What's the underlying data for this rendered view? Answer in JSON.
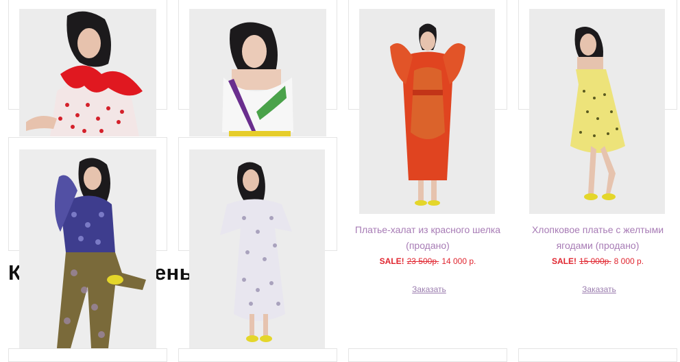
{
  "section_heading": "Коллекция осень-зима 2015",
  "products": [
    {
      "name": "Платье-халат из красного шелка (продано)",
      "sale_label": "SALE!",
      "old_price": "23 500р.",
      "new_price": "14 000 р.",
      "order_label": "Заказать"
    },
    {
      "name": "Хлопковое платье с желтыми ягодами (продано)",
      "sale_label": "SALE!",
      "old_price": "15 000р.",
      "new_price": "8 000 р.",
      "order_label": "Заказать"
    }
  ],
  "colors": {
    "product_link": "#a77bb5",
    "sale_price": "#e0242e",
    "order_link": "#9a7cae"
  }
}
